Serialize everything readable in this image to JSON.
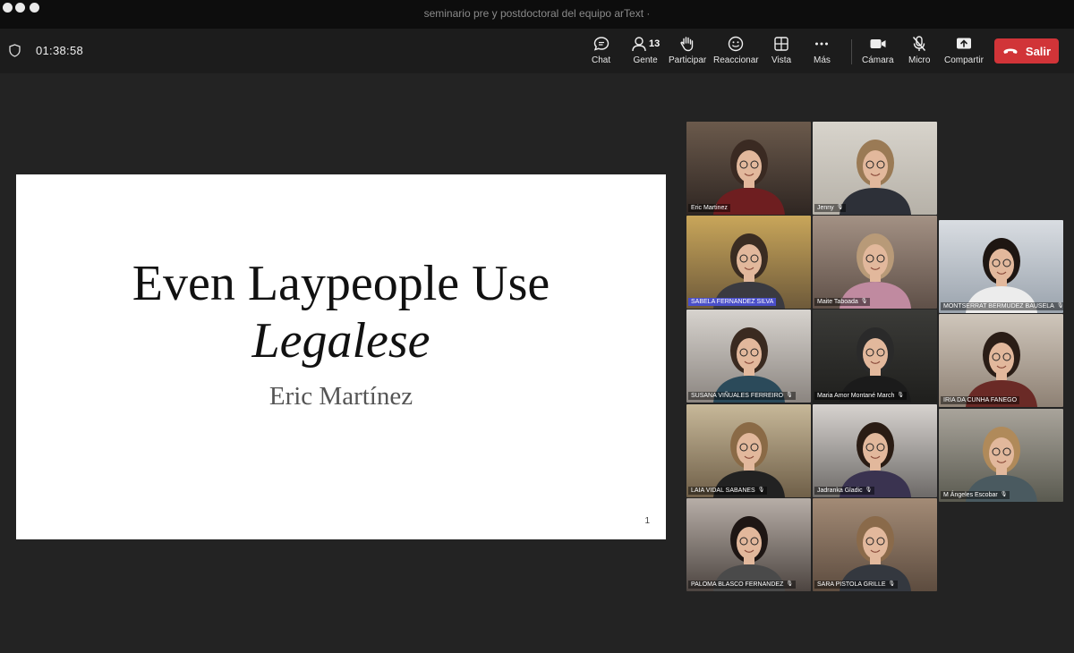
{
  "window": {
    "title": "seminario pre y postdoctoral del equipo arText ·"
  },
  "toolbar": {
    "timer": "01:38:58",
    "chat_label": "Chat",
    "people_label": "Gente",
    "people_count": "13",
    "raise_label": "Participar",
    "react_label": "Reaccionar",
    "view_label": "Vista",
    "more_label": "Más",
    "camera_label": "Cámara",
    "mic_label": "Micro",
    "share_label": "Compartir",
    "leave_label": "Salir",
    "leave_color": "#d13438"
  },
  "slide": {
    "title_line1": "Even Laypeople Use",
    "title_line2": "Legalese",
    "author": "Eric Martínez",
    "page_number": "1"
  },
  "participants": [
    {
      "name": "Eric Martinez",
      "muted": false
    },
    {
      "name": "Jenny",
      "muted": true
    },
    {
      "name": "SABELA FERNANDEZ SILVA",
      "muted": false,
      "highlighted": true
    },
    {
      "name": "Maite Taboada",
      "muted": true
    },
    {
      "name": "MONTSERRAT BERMUDEZ BAUSELA",
      "muted": true
    },
    {
      "name": "SUSANA VIÑUALES FERREIRO",
      "muted": true
    },
    {
      "name": "Maria Amor Montané March",
      "muted": true
    },
    {
      "name": "IRIA DA CUNHA FANEGO",
      "muted": false
    },
    {
      "name": "LAIA VIDAL SABANES",
      "muted": true
    },
    {
      "name": "Jadranka Gladic",
      "muted": true
    },
    {
      "name": "M Ángeles Escobar",
      "muted": true
    },
    {
      "name": "PALOMA BLASCO FERNANDEZ",
      "muted": true
    },
    {
      "name": "SARA PISTOLA GRILLE",
      "muted": true
    }
  ]
}
